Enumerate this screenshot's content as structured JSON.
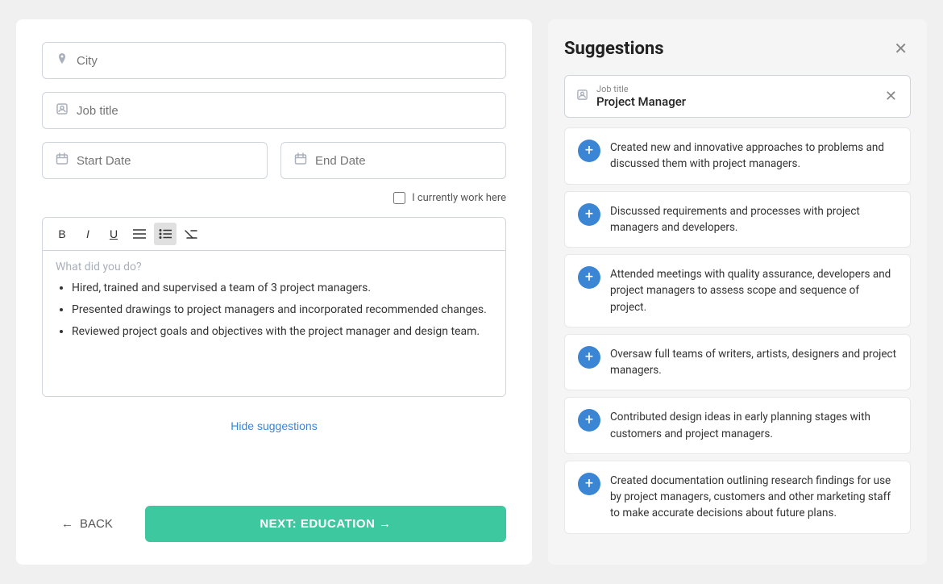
{
  "left_panel": {
    "city_placeholder": "City",
    "job_title_placeholder": "Job title",
    "start_date_placeholder": "Start Date",
    "end_date_placeholder": "End Date",
    "currently_work_label": "I currently work here",
    "editor_placeholder": "What did you do?",
    "editor_bullets": [
      "Hired, trained and supervised a team of 3 project managers.",
      "Presented drawings to project managers and incorporated recommended changes.",
      "Reviewed project goals and objectives with the project manager and design team."
    ],
    "hide_suggestions_label": "Hide suggestions",
    "back_label": "BACK",
    "next_label": "NEXT: EDUCATION"
  },
  "right_panel": {
    "title": "Suggestions",
    "filter_label": "Job title",
    "filter_value": "Project Manager",
    "suggestions": [
      "Created new and innovative approaches to problems and discussed them with project managers.",
      "Discussed requirements and processes with project managers and developers.",
      "Attended meetings with quality assurance, developers and project managers to assess scope and sequence of project.",
      "Oversaw full teams of writers, artists, designers and project managers.",
      "Contributed design ideas in early planning stages with customers and project managers.",
      "Created documentation outlining research findings for use by project managers, customers and other marketing staff to make accurate decisions about future plans."
    ]
  },
  "toolbar": {
    "bold": "B",
    "italic": "I",
    "underline": "U",
    "align": "≡",
    "list": "☰",
    "clear": "✕"
  },
  "icons": {
    "location": "⊙",
    "person": "⊡",
    "calendar": "⊞",
    "add": "+",
    "close": "✕",
    "back_arrow": "←",
    "next_arrow": "→"
  }
}
